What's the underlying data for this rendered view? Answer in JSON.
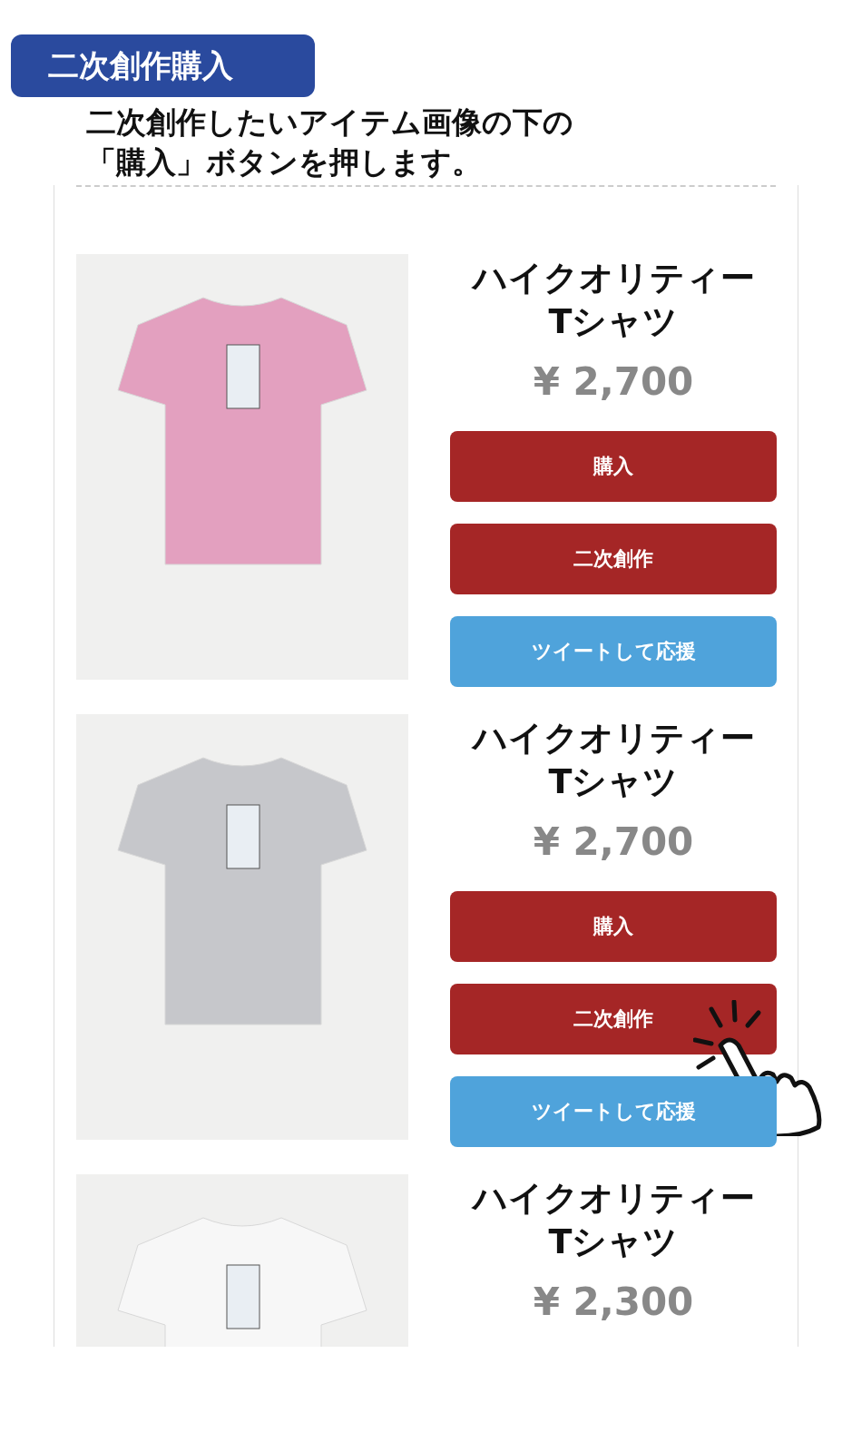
{
  "badge": "二次創作購入",
  "instruction": [
    "二次創作したいアイテム画像の下の",
    "「購入」ボタンを押します。"
  ],
  "products": [
    {
      "title": [
        "ハイクオリティー",
        "Tシャツ"
      ],
      "price": "¥ 2,700",
      "color": "#e3a0bf",
      "pointer": false,
      "buttons": [
        {
          "kind": "buy",
          "label": "購入"
        },
        {
          "kind": "derive",
          "label": "二次創作"
        },
        {
          "kind": "tweet",
          "label": "ツイートして応援"
        }
      ]
    },
    {
      "title": [
        "ハイクオリティー",
        "Tシャツ"
      ],
      "price": "¥ 2,700",
      "color": "#c6c7cb",
      "pointer": true,
      "buttons": [
        {
          "kind": "buy",
          "label": "購入"
        },
        {
          "kind": "derive",
          "label": "二次創作"
        },
        {
          "kind": "tweet",
          "label": "ツイートして応援"
        }
      ]
    },
    {
      "title": [
        "ハイクオリティー",
        "Tシャツ"
      ],
      "price": "¥ 2,300",
      "color": "#f7f7f7",
      "pointer": false
    }
  ]
}
